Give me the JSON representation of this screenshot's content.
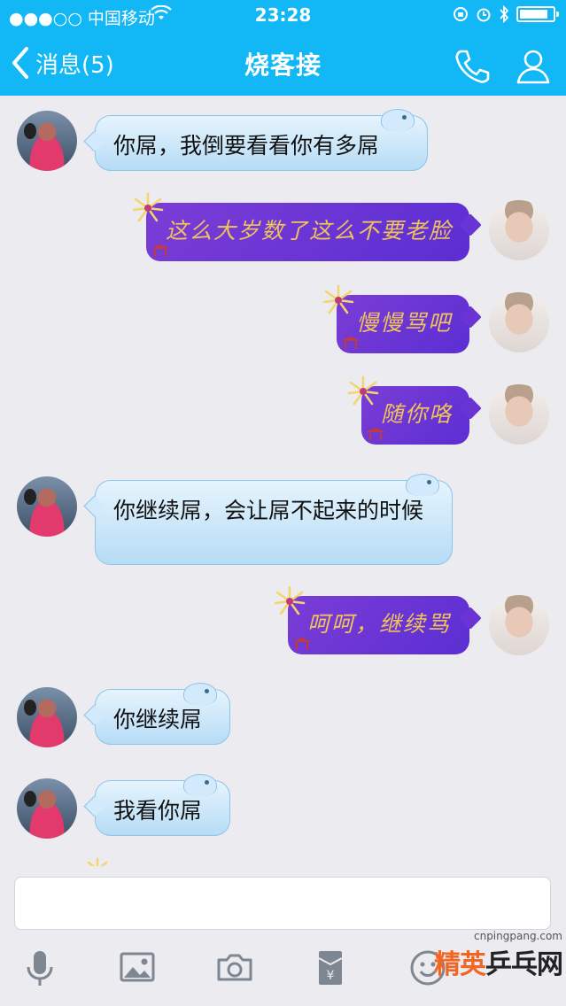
{
  "status_bar": {
    "carrier": "●●●○○ 中国移动",
    "time": "23:28",
    "battery_level": 0.85
  },
  "header": {
    "back_label": "消息(5)",
    "title": "烧客接"
  },
  "messages": [
    {
      "side": "in",
      "text": "你屌，我倒要看看你有多屌"
    },
    {
      "side": "out",
      "text": "这么大岁数了这么不要老脸"
    },
    {
      "side": "out",
      "text": "慢慢骂吧"
    },
    {
      "side": "out",
      "text": "随你咯"
    },
    {
      "side": "in",
      "text": "你继续屌，会让屌不起来的时候"
    },
    {
      "side": "out",
      "text": "呵呵，继续骂"
    },
    {
      "side": "in",
      "text": "你继续屌"
    },
    {
      "side": "in",
      "text": "我看你屌"
    }
  ],
  "input": {
    "value": "",
    "placeholder": ""
  },
  "toolbar_icons": [
    "microphone-icon",
    "image-icon",
    "camera-icon",
    "red-packet-icon",
    "emoji-icon"
  ],
  "watermark": {
    "url": "cnpingpang.com",
    "logo_part1": "精英",
    "logo_part2": "乒乓网"
  },
  "colors": {
    "header_bg": "#12b7f5",
    "incoming_bubble": "#c6e4f8",
    "outgoing_bubble": "#6a33d4",
    "outgoing_text": "#f0c35a"
  }
}
